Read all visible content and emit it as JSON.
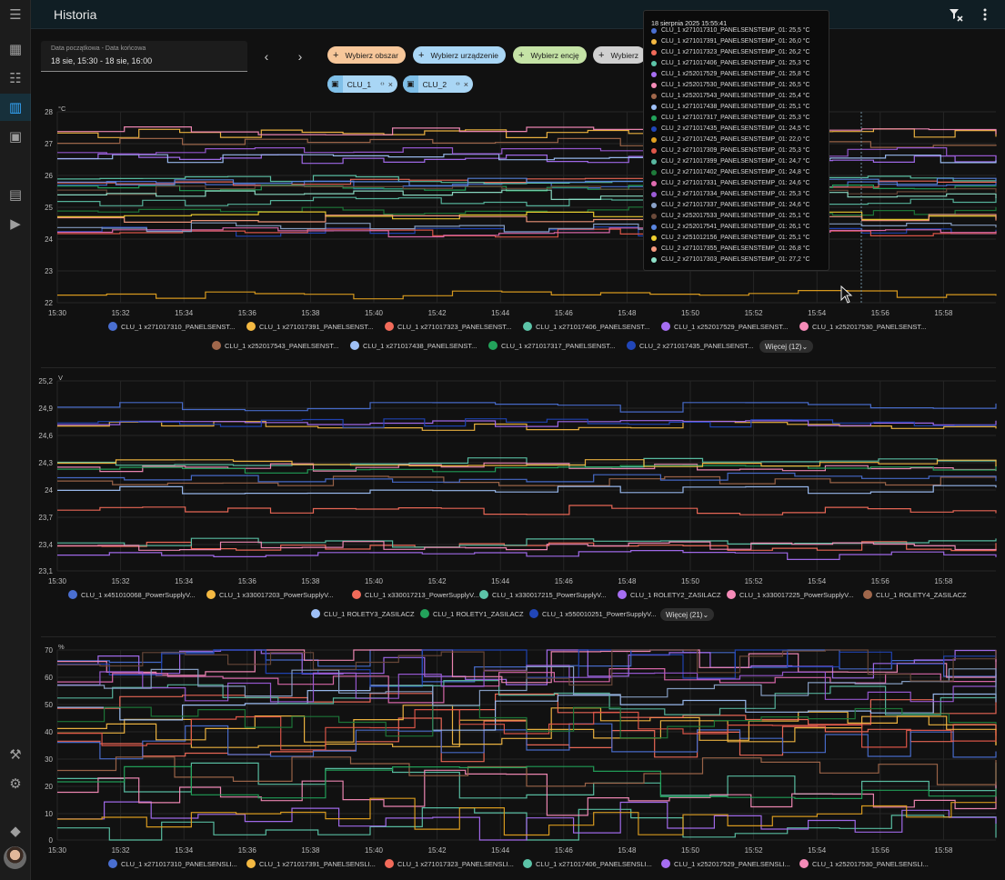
{
  "app": {
    "title": "Historia"
  },
  "sidebar": {
    "items": [
      {
        "icon": "menu-icon",
        "glyph": "☰"
      },
      {
        "icon": "dashboard-icon",
        "glyph": "▦"
      },
      {
        "icon": "list-icon",
        "glyph": "☷"
      },
      {
        "icon": "history-icon",
        "glyph": "▥",
        "active": true
      },
      {
        "icon": "calendar-icon",
        "glyph": "▣"
      },
      {
        "icon": "clipboard-icon",
        "glyph": "▤"
      },
      {
        "icon": "media-icon",
        "glyph": "▶"
      },
      {
        "icon": "wrench-icon",
        "glyph": "⚒"
      },
      {
        "icon": "settings-icon",
        "glyph": "⚙"
      },
      {
        "icon": "bell-icon",
        "glyph": "◆"
      }
    ]
  },
  "date_picker": {
    "label": "Data początkowa - Data końcowa",
    "value": "18 sie, 15:30 - 18 sie, 16:00"
  },
  "target_chips": [
    {
      "label": "Wybierz obszar",
      "color": "#f7c79a"
    },
    {
      "label": "Wybierz urządzenie",
      "color": "#a9d6f5"
    },
    {
      "label": "Wybierz encję",
      "color": "#c5e3a6"
    },
    {
      "label": "Wybierz",
      "color": "#d0d0d0"
    }
  ],
  "selected_targets": [
    {
      "label": "CLU_1",
      "code": "‹›",
      "remove": "×"
    },
    {
      "label": "CLU_2",
      "code": "‹›",
      "remove": "×"
    }
  ],
  "tooltip": {
    "title": "18 sierpnia 2025 15:55:41",
    "rows": [
      {
        "text": "CLU_1 x271017310_PANELSENSTEMP_01: 25,5 °C",
        "color": "#4a6fd1"
      },
      {
        "text": "CLU_1 x271017391_PANELSENSTEMP_01: 26,0 °C",
        "color": "#f4b942"
      },
      {
        "text": "CLU_1 x271017323_PANELSENSTEMP_01: 26,2 °C",
        "color": "#f26b5a"
      },
      {
        "text": "CLU_1 x271017406_PANELSENSTEMP_01: 25,3 °C",
        "color": "#5cc4a8"
      },
      {
        "text": "CLU_1 x252017529_PANELSENSTEMP_01: 25,8 °C",
        "color": "#a66ef2"
      },
      {
        "text": "CLU_1 x252017530_PANELSENSTEMP_01: 26,5 °C",
        "color": "#f58bb8"
      },
      {
        "text": "CLU_1 x252017543_PANELSENSTEMP_01: 25,4 °C",
        "color": "#a0674b"
      },
      {
        "text": "CLU_1 x271017438_PANELSENSTEMP_01: 25,1 °C",
        "color": "#9ec0f7"
      },
      {
        "text": "CLU_1 x271017317_PANELSENSTEMP_01: 25,3 °C",
        "color": "#23a35b"
      },
      {
        "text": "CLU_2 x271017435_PANELSENSTEMP_01: 24,5 °C",
        "color": "#2146b8"
      },
      {
        "text": "CLU_2 x271017425_PANELSENSTEMP_01: 22,0 °C",
        "color": "#e0a020"
      },
      {
        "text": "CLU_2 x271017309_PANELSENSTEMP_01: 25,3 °C",
        "color": "#e0574a"
      },
      {
        "text": "CLU_2 x271017399_PANELSENSTEMP_01: 24,7 °C",
        "color": "#58b8a0"
      },
      {
        "text": "CLU_2 x271017402_PANELSENSTEMP_01: 24,8 °C",
        "color": "#1e7a3a"
      },
      {
        "text": "CLU_2 x271017331_PANELSENSTEMP_01: 24,6 °C",
        "color": "#e06bb0"
      },
      {
        "text": "CLU_2 x271017334_PANELSENSTEMP_01: 25,3 °C",
        "color": "#9b5bd6"
      },
      {
        "text": "CLU_2 x271017337_PANELSENSTEMP_01: 24,6 °C",
        "color": "#8aa2c8"
      },
      {
        "text": "CLU_2 x252017533_PANELSENSTEMP_01: 25,1 °C",
        "color": "#6b4a3a"
      },
      {
        "text": "CLU_2 x252017541_PANELSENSTEMP_01: 26,1 °C",
        "color": "#5a86e0"
      },
      {
        "text": "CLU_2 x251012156_PANELSENSTEMP_01: 25,1 °C",
        "color": "#f0d030"
      },
      {
        "text": "CLU_2 x271017355_PANELSENSTEMP_01: 26,8 °C",
        "color": "#f59a80"
      },
      {
        "text": "CLU_2 x271017303_PANELSENSTEMP_01: 27,2 °C",
        "color": "#8ee0c8"
      }
    ]
  },
  "x_ticks": [
    "15:30",
    "15:32",
    "15:34",
    "15:36",
    "15:38",
    "15:40",
    "15:42",
    "15:44",
    "15:46",
    "15:48",
    "15:50",
    "15:52",
    "15:54",
    "15:56",
    "15:58"
  ],
  "charts": [
    {
      "unit": "°C",
      "y_ticks": [
        "28",
        "27",
        "26",
        "25",
        "24",
        "23",
        "22"
      ],
      "legend": [
        {
          "label": "CLU_1 x271017310_PANELSENST...",
          "color": "#4a6fd1"
        },
        {
          "label": "CLU_1 x271017391_PANELSENST...",
          "color": "#f4b942"
        },
        {
          "label": "CLU_1 x271017323_PANELSENST...",
          "color": "#f26b5a"
        },
        {
          "label": "CLU_1 x271017406_PANELSENST...",
          "color": "#5cc4a8"
        },
        {
          "label": "CLU_1 x252017529_PANELSENST...",
          "color": "#a66ef2"
        },
        {
          "label": "CLU_1 x252017530_PANELSENST...",
          "color": "#f58bb8"
        },
        {
          "label": "CLU_1 x252017543_PANELSENST...",
          "color": "#a0674b"
        },
        {
          "label": "CLU_1 x271017438_PANELSENST...",
          "color": "#9ec0f7"
        },
        {
          "label": "CLU_1 x271017317_PANELSENST...",
          "color": "#23a35b"
        },
        {
          "label": "CLU_2 x271017435_PANELSENST...",
          "color": "#2146b8"
        }
      ],
      "more": "Więcej (12)"
    },
    {
      "unit": "V",
      "y_ticks": [
        "25,2",
        "24,9",
        "24,6",
        "24,3",
        "24",
        "23,7",
        "23,4",
        "23,1"
      ],
      "legend": [
        {
          "label": "CLU_1 x451010068_PowerSupplyV...",
          "color": "#4a6fd1"
        },
        {
          "label": "CLU_1 x330017203_PowerSupplyV...",
          "color": "#f4b942"
        },
        {
          "label": "CLU_1 x330017213_PowerSupplyV...",
          "color": "#f26b5a"
        },
        {
          "label": "CLU_1 x330017215_PowerSupplyV...",
          "color": "#5cc4a8"
        },
        {
          "label": "CLU_1 ROLETY2_ZASILACZ",
          "color": "#a66ef2"
        },
        {
          "label": "CLU_1 x330017225_PowerSupplyV...",
          "color": "#f58bb8"
        },
        {
          "label": "CLU_1 ROLETY4_ZASILACZ",
          "color": "#a0674b"
        },
        {
          "label": "CLU_1 ROLETY3_ZASILACZ",
          "color": "#9ec0f7"
        },
        {
          "label": "CLU_1 ROLETY1_ZASILACZ",
          "color": "#23a35b"
        },
        {
          "label": "CLU_1 x550010251_PowerSupplyV...",
          "color": "#2146b8"
        }
      ],
      "more": "Więcej (21)"
    },
    {
      "unit": "%",
      "y_ticks": [
        "70",
        "60",
        "50",
        "40",
        "30",
        "20",
        "10",
        "0"
      ],
      "legend": [
        {
          "label": "CLU_1 x271017310_PANELSENSLI...",
          "color": "#4a6fd1"
        },
        {
          "label": "CLU_1 x271017391_PANELSENSLI...",
          "color": "#f4b942"
        },
        {
          "label": "CLU_1 x271017323_PANELSENSLI...",
          "color": "#f26b5a"
        },
        {
          "label": "CLU_1 x271017406_PANELSENSLI...",
          "color": "#5cc4a8"
        },
        {
          "label": "CLU_1 x252017529_PANELSENSLI...",
          "color": "#a66ef2"
        },
        {
          "label": "CLU_1 x252017530_PANELSENSLI...",
          "color": "#f58bb8"
        }
      ]
    }
  ]
}
